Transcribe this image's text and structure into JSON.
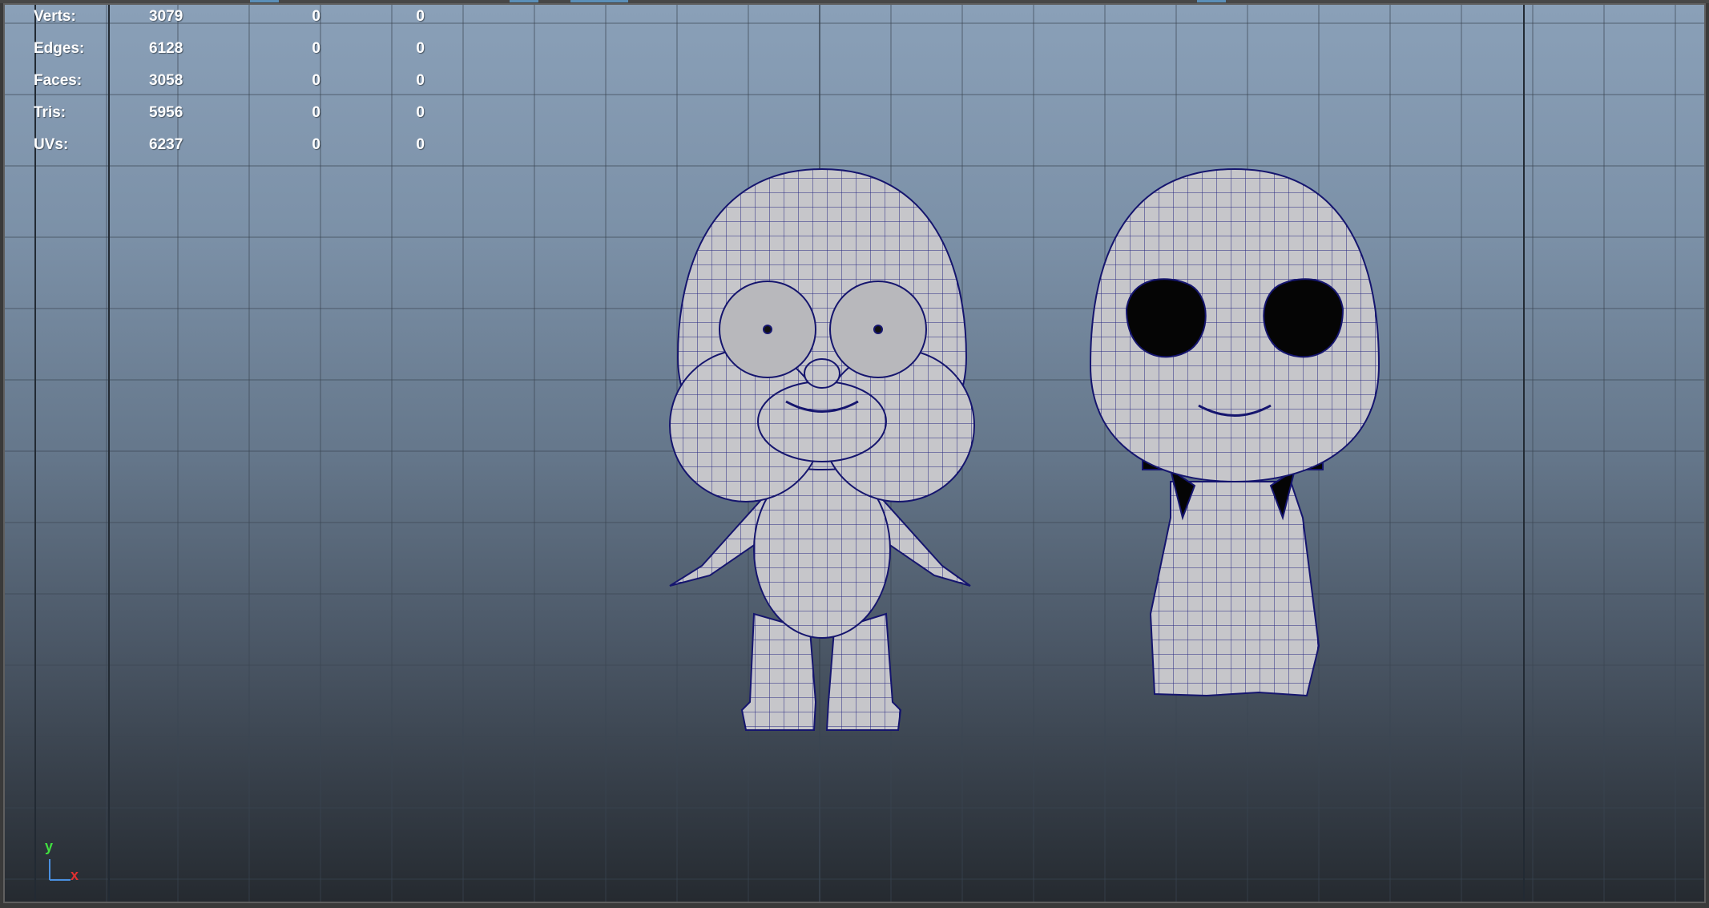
{
  "viewport": {
    "hud": {
      "rows": [
        {
          "label": "Verts:",
          "count": "3079",
          "selected": "0",
          "uv_sel": "0"
        },
        {
          "label": "Edges:",
          "count": "6128",
          "selected": "0",
          "uv_sel": "0"
        },
        {
          "label": "Faces:",
          "count": "3058",
          "selected": "0",
          "uv_sel": "0"
        },
        {
          "label": "Tris:",
          "count": "5956",
          "selected": "0",
          "uv_sel": "0"
        },
        {
          "label": "UVs:",
          "count": "6237",
          "selected": "0",
          "uv_sel": "0"
        }
      ]
    },
    "axis": {
      "y_label": "y",
      "x_label": "x"
    },
    "colors": {
      "grid_line": "#3a4552",
      "mesh_fill": "#c9c9cc",
      "wireframe": "#1a1a7a",
      "axis_x": "#e03030",
      "axis_y": "#30d030"
    },
    "models": [
      {
        "name": "character-front-view-icon"
      },
      {
        "name": "character-front-view-alt-icon"
      }
    ]
  }
}
